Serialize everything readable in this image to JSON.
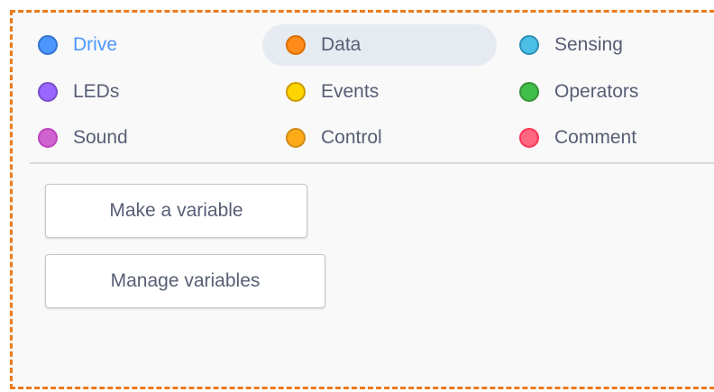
{
  "categories": [
    {
      "label": "Drive",
      "color": "#4c97ff",
      "border": "#3373cc",
      "selected": true
    },
    {
      "label": "Data",
      "color": "#ff8c1a",
      "border": "#db6e00",
      "hovered": true
    },
    {
      "label": "Sensing",
      "color": "#4cbfe6",
      "border": "#2e8eb8"
    },
    {
      "label": "LEDs",
      "color": "#9966ff",
      "border": "#774dcb"
    },
    {
      "label": "Events",
      "color": "#ffd500",
      "border": "#cc9900"
    },
    {
      "label": "Operators",
      "color": "#40bf4a",
      "border": "#389438"
    },
    {
      "label": "Sound",
      "color": "#cf63cf",
      "border": "#bd42bd"
    },
    {
      "label": "Control",
      "color": "#ffab19",
      "border": "#cf8b17"
    },
    {
      "label": "Comment",
      "color": "#ff6680",
      "border": "#ff3355"
    }
  ],
  "buttons": {
    "make_variable": "Make a variable",
    "manage_variables": "Manage variables"
  },
  "colors": {
    "frame_border": "#ec7a1c",
    "label_text": "#575e75",
    "selected_text": "#4c97ff",
    "hover_bg": "#e6ebf2"
  }
}
